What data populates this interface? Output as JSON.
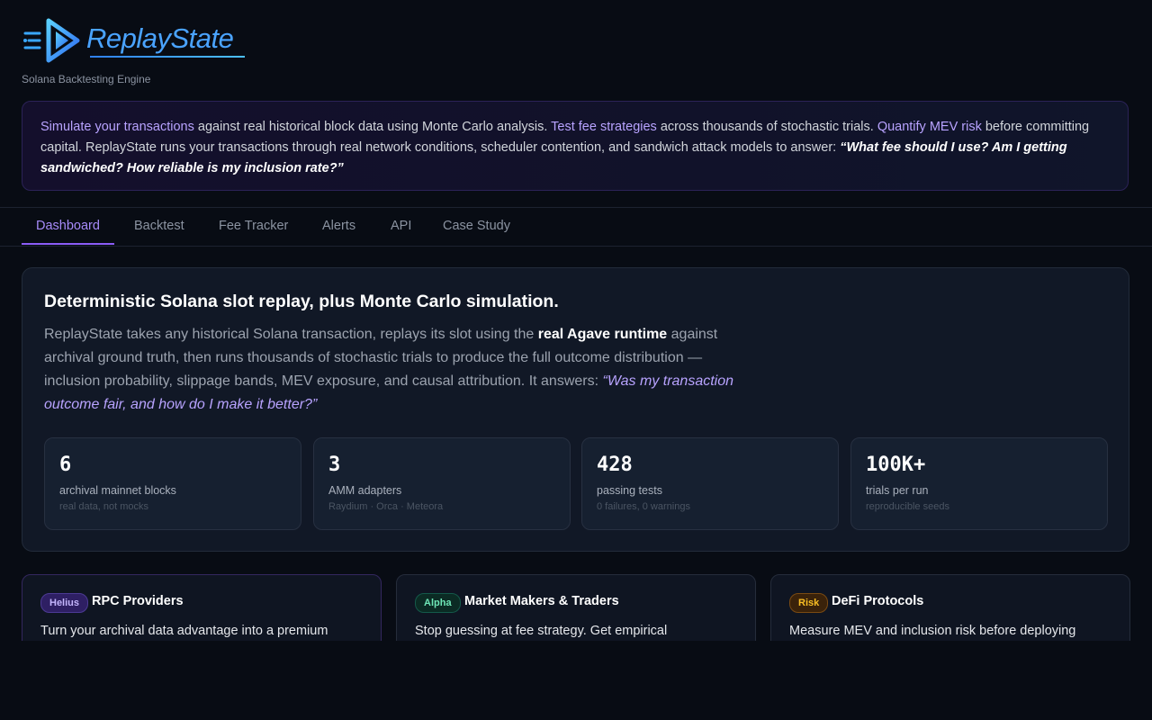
{
  "header": {
    "brand": "ReplayState",
    "tagline": "Solana Backtesting Engine",
    "logo_icon": "play-icon",
    "brand_color": "#4aa3ff"
  },
  "intro": {
    "hl1": "Simulate your transactions",
    "t1": " against real historical block data using Monte Carlo analysis. ",
    "hl2": "Test fee strategies",
    "t2": " across thousands of stochastic trials. ",
    "hl3": "Quantify MEV risk",
    "t3": " before committing capital. ReplayState runs your transactions through real network conditions, scheduler contention, and sandwich attack models to answer: ",
    "question": "“What fee should I use? Am I getting sandwiched? How reliable is my inclusion rate?”"
  },
  "tabs": [
    "Dashboard",
    "Backtest",
    "Fee Tracker",
    "Alerts",
    "API",
    "Case Study"
  ],
  "active_tab": "Dashboard",
  "hero": {
    "title": "Deterministic Solana slot replay, plus Monte Carlo simulation.",
    "d1": "ReplayState takes any historical Solana transaction, replays its slot using the ",
    "strong": "real Agave runtime",
    "d2": " against archival ground truth, then runs thousands of stochastic trials to produce the full outcome distribution — inclusion probability, slippage bands, MEV exposure, and causal attribution. It answers: ",
    "quote": "“Was my transaction outcome fair, and how do I make it better?”"
  },
  "stats": [
    {
      "value": "6",
      "label": "archival mainnet blocks",
      "sub": "real data, not mocks"
    },
    {
      "value": "3",
      "label": "AMM adapters",
      "sub": "Raydium · Orca · Meteora"
    },
    {
      "value": "428",
      "label": "passing tests",
      "sub": "0 failures, 0 warnings"
    },
    {
      "value": "100K+",
      "label": "trials per run",
      "sub": "reproducible seeds"
    }
  ],
  "cards": [
    {
      "badge": "Helius",
      "title": "RPC Providers",
      "desc": "Turn your archival data advantage into a premium"
    },
    {
      "badge": "Alpha",
      "title": "Market Makers & Traders",
      "desc": "Stop guessing at fee strategy. Get empirical"
    },
    {
      "badge": "Risk",
      "title": "DeFi Protocols",
      "desc": "Measure MEV and inclusion risk before deploying"
    }
  ],
  "colors": {
    "accent": "#8b5cf6",
    "highlight": "#b8a3ff",
    "background": "#080c14"
  }
}
